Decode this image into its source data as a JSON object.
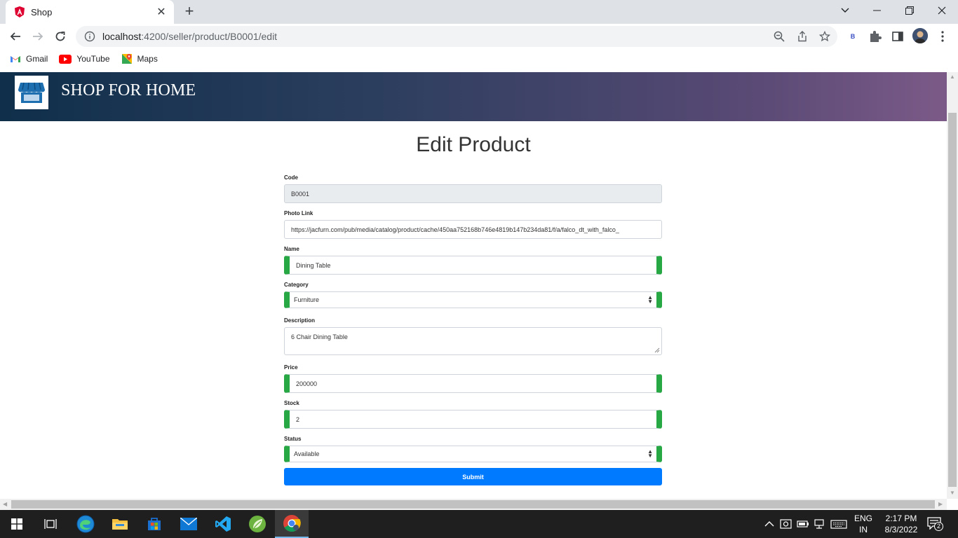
{
  "browser": {
    "tab_title": "Shop",
    "url_host": "localhost",
    "url_rest": ":4200/seller/product/B0001/edit",
    "profile_initial": "B",
    "bookmarks": [
      {
        "label": "Gmail",
        "icon": "gmail-icon"
      },
      {
        "label": "YouTube",
        "icon": "youtube-icon"
      },
      {
        "label": "Maps",
        "icon": "maps-icon"
      }
    ]
  },
  "site": {
    "brand": "SHOP FOR HOME"
  },
  "page": {
    "title": "Edit Product"
  },
  "form": {
    "code_label": "Code",
    "code_value": "B0001",
    "photo_label": "Photo Link",
    "photo_value": "https://jacfurn.com/pub/media/catalog/product/cache/450aa752168b746e4819b147b234da81/f/a/falco_dt_with_falco_",
    "name_label": "Name",
    "name_value": "Dining Table",
    "category_label": "Category",
    "category_value": "Furniture",
    "description_label": "Description",
    "description_value": "6 Chair Dining Table",
    "price_label": "Price",
    "price_value": "200000",
    "stock_label": "Stock",
    "stock_value": "2",
    "status_label": "Status",
    "status_value": "Available",
    "submit_label": "Submit"
  },
  "taskbar": {
    "lang_top": "ENG",
    "lang_bottom": "IN",
    "time": "2:17 PM",
    "date": "8/3/2022",
    "notification_count": "2"
  },
  "colors": {
    "valid": "#28a745",
    "primary": "#007bff",
    "header_start": "#0f2f4a",
    "header_end": "#7c5a88"
  }
}
